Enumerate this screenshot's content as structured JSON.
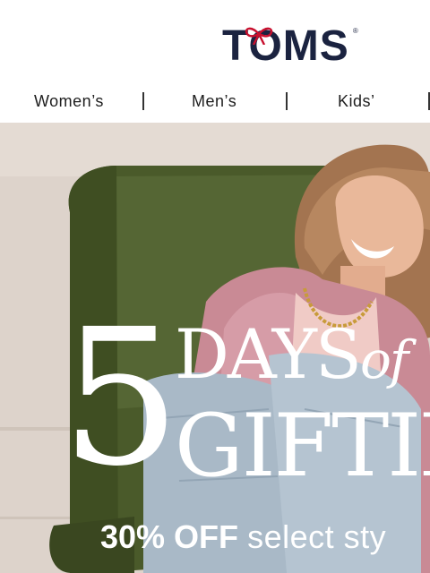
{
  "header": {
    "brand": "TOMS",
    "registered_mark": "®"
  },
  "nav": {
    "items": [
      "Women’s",
      "Men’s",
      "Kids’"
    ]
  },
  "hero": {
    "number": "5",
    "line1": "DAYS",
    "line1_italic": "of",
    "line2": "GIFTIN",
    "promo_bold": "30% OFF",
    "promo_light": "select sty"
  },
  "colors": {
    "brand_navy": "#1b2340",
    "bow_red": "#c8102e",
    "chair_green": "#4a5a2a",
    "wall": "#ddd3cb"
  }
}
